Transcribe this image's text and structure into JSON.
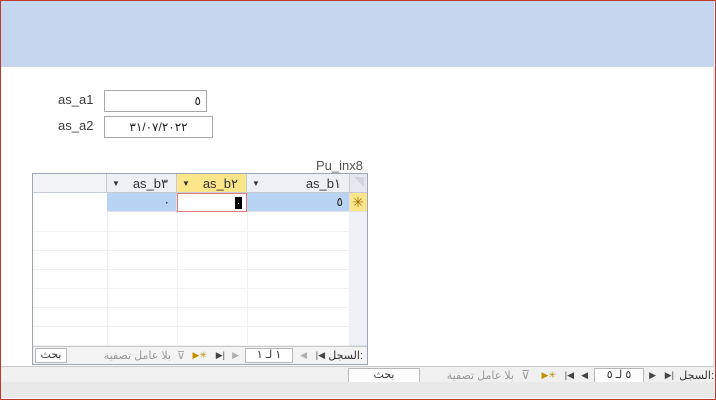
{
  "form": {
    "field_a1_label": "as_a1",
    "field_a1_value": "٥",
    "field_a2_label": "as_a2",
    "field_a2_value": "٣١/٠٧/٢٠٢٢"
  },
  "subform": {
    "caption": "Pu_inx8",
    "columns": [
      "as_b١",
      "as_b٢",
      "as_b٣"
    ],
    "new_row": {
      "as_b1": "٥",
      "as_b2": "٠",
      "as_b3": "٠"
    },
    "new_row_marker": "✳",
    "nav": {
      "record_label": "السجل:",
      "position": "١ لـ ١",
      "filter_label": "بلا عامل تصفية",
      "search_label": "بحث"
    }
  },
  "main_nav": {
    "record_label": "السجل:",
    "position": "٥ لـ ٥",
    "filter_label": "بلا عامل تصفية",
    "search_label": "بحث"
  },
  "colors": {
    "header_band": "#c5d7ee",
    "selected_header": "#fde68a",
    "selected_cell": "#b9d3f5"
  }
}
